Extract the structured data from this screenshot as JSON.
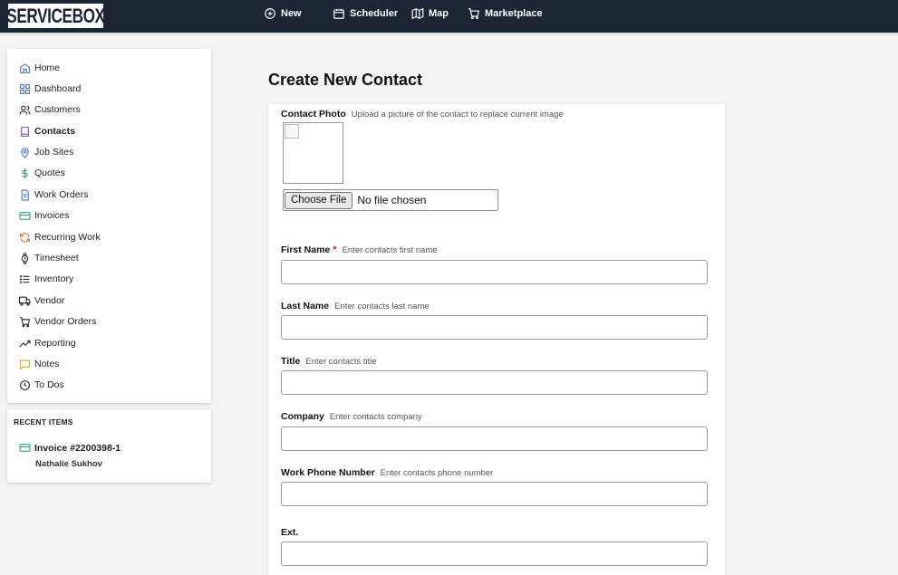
{
  "brand": {
    "logo_text": "SERVICEBOX"
  },
  "topnav": [
    {
      "label": "New",
      "icon": "plus-circle-icon"
    },
    {
      "label": "Scheduler",
      "icon": "calendar-icon"
    },
    {
      "label": "Map",
      "icon": "map-icon"
    },
    {
      "label": "Marketplace",
      "icon": "cart-icon"
    }
  ],
  "sidebar": {
    "items": [
      {
        "label": "Home",
        "icon": "home-icon"
      },
      {
        "label": "Dashboard",
        "icon": "dashboard-grid-icon"
      },
      {
        "label": "Customers",
        "icon": "users-icon"
      },
      {
        "label": "Contacts",
        "icon": "contact-book-icon",
        "active": true
      },
      {
        "label": "Job Sites",
        "icon": "map-pin-icon"
      },
      {
        "label": "Quotes",
        "icon": "dollar-icon"
      },
      {
        "label": "Work Orders",
        "icon": "document-icon"
      },
      {
        "label": "Invoices",
        "icon": "credit-card-icon"
      },
      {
        "label": "Recurring Work",
        "icon": "refresh-icon"
      },
      {
        "label": "Timesheet",
        "icon": "watch-icon"
      },
      {
        "label": "Inventory",
        "icon": "list-icon"
      },
      {
        "label": "Vendor",
        "icon": "truck-icon"
      },
      {
        "label": "Vendor Orders",
        "icon": "cart-icon"
      },
      {
        "label": "Reporting",
        "icon": "trending-up-icon"
      },
      {
        "label": "Notes",
        "icon": "message-square-icon"
      },
      {
        "label": "To Dos",
        "icon": "clock-icon"
      }
    ]
  },
  "recent": {
    "title": "RECENT ITEMS",
    "item": {
      "label": "Invoice #2200398-1",
      "sub": "Nathalie Sukhov",
      "icon": "credit-card-icon"
    }
  },
  "page": {
    "title": "Create New Contact"
  },
  "form": {
    "photo": {
      "label": "Contact Photo",
      "hint": "Upload a picture of the contact to replace current image",
      "button": "Choose File",
      "status": "No file chosen"
    },
    "fields": [
      {
        "label": "First Name",
        "required": "*",
        "hint": "Enter contacts first name",
        "value": ""
      },
      {
        "label": "Last Name",
        "hint": "Enter contacts last name",
        "value": ""
      },
      {
        "label": "Title",
        "hint": "Enter contacts title",
        "value": ""
      },
      {
        "label": "Company",
        "hint": "Enter contacts company",
        "value": ""
      },
      {
        "label": "Work Phone Number",
        "hint": "Enter contacts phone number",
        "value": ""
      },
      {
        "label": "Ext.",
        "hint": "",
        "value": ""
      }
    ]
  },
  "colors": {
    "topbar": "#1b2536",
    "required": "#d21f1f",
    "icon_blue": "#4a6fd1",
    "icon_purple": "#7a4fc9",
    "icon_green": "#2fa36b",
    "icon_orange": "#e86a2a",
    "icon_yellow": "#e0a81e"
  }
}
